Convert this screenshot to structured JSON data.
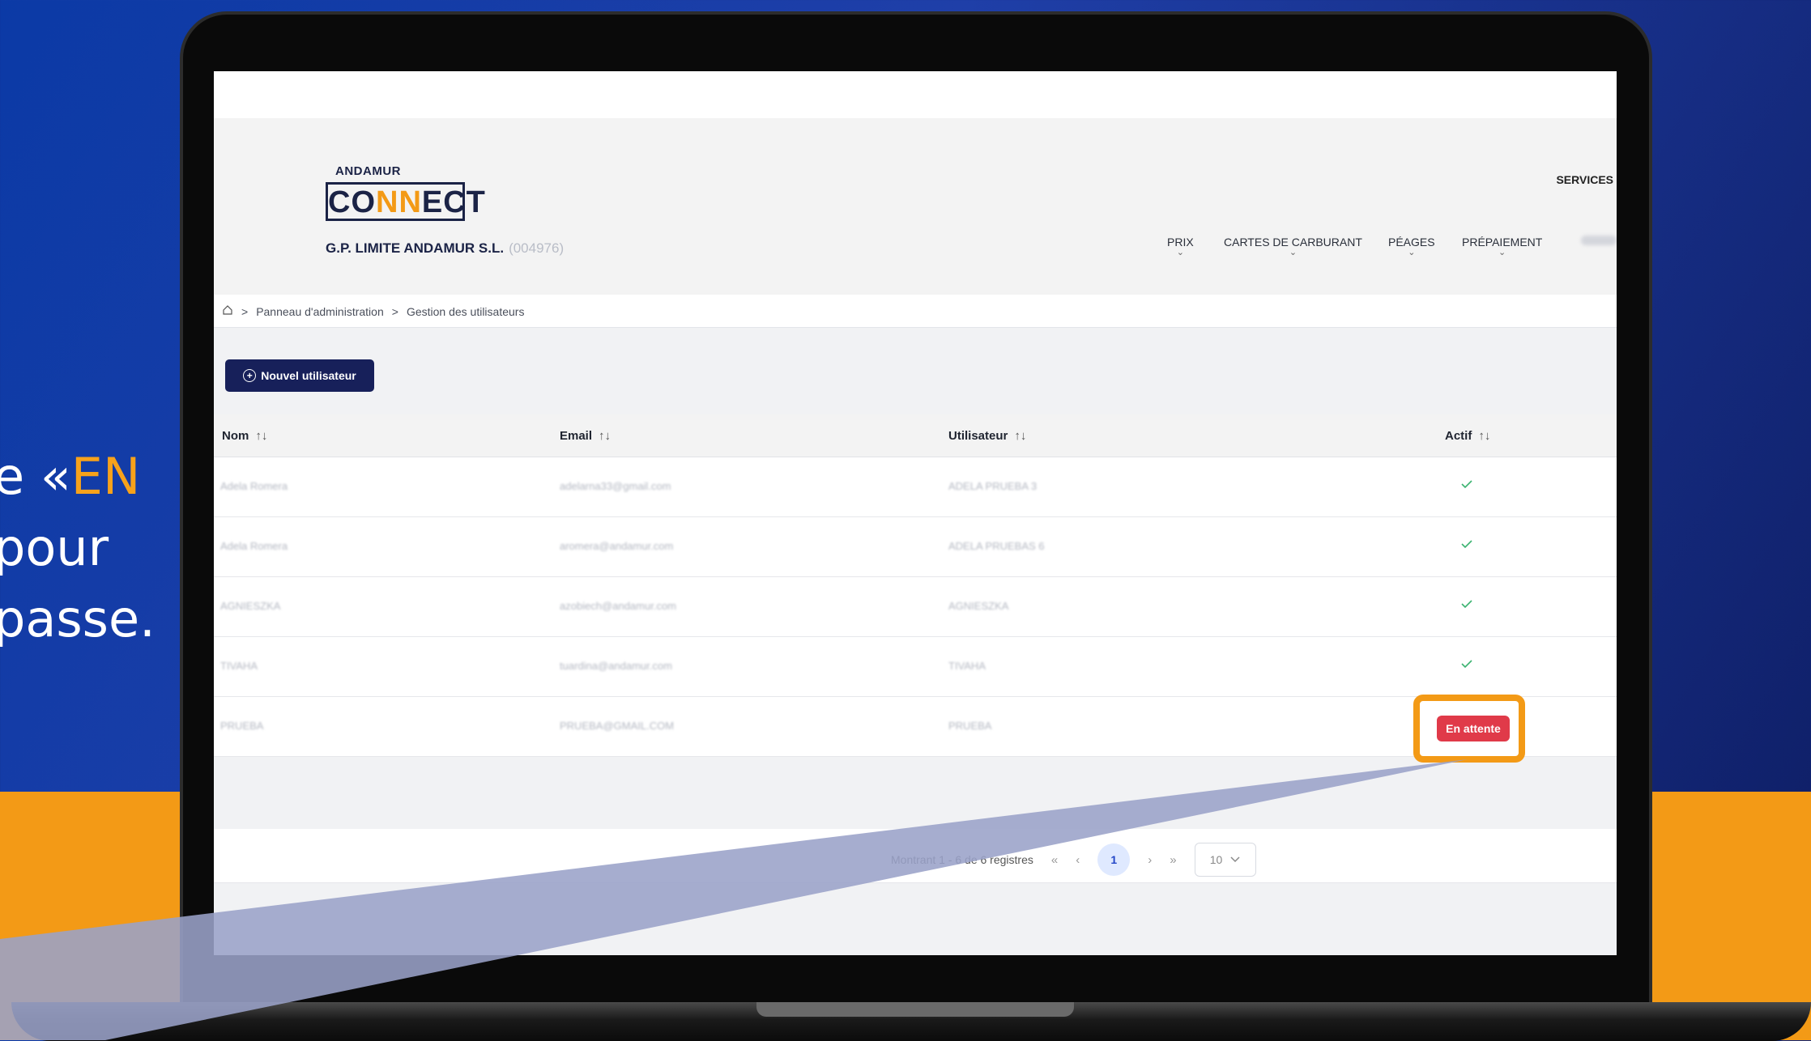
{
  "side_text": {
    "line1_prefix": "e «",
    "line1_highlight": "EN",
    "line2": "pour",
    "line3": "passe."
  },
  "logo": {
    "small": "ANDAMUR",
    "main_a": "CO",
    "main_b": "NN",
    "main_c": "ECT"
  },
  "company": {
    "name": "G.P. LIMITE ANDAMUR S.L.",
    "id": "(004976)"
  },
  "nav": {
    "services": "SERVICES",
    "items": [
      {
        "label": "PRIX",
        "chevron": "⌄"
      },
      {
        "label": "CARTES DE CARBURANT",
        "chevron": "⌄"
      },
      {
        "label": "PÉAGES",
        "chevron": "⌄"
      },
      {
        "label": "PRÉPAIEMENT",
        "chevron": "⌄"
      }
    ]
  },
  "breadcrumb": {
    "home_icon": "home-icon",
    "item1": "Panneau d'administration",
    "item2": "Gestion des utilisateurs",
    "separator": ">"
  },
  "new_user_button": "Nouvel utilisateur",
  "table": {
    "headers": [
      "Nom",
      "Email",
      "Utilisateur",
      "Actif"
    ],
    "sort_glyph": "↑↓",
    "rows": [
      {
        "nom": "Adela Romera",
        "email": "adelarna33@gmail.com",
        "user": "ADELA PRUEBA 3",
        "status": "active"
      },
      {
        "nom": "Adela Romera",
        "email": "aromera@andamur.com",
        "user": "ADELA PRUEBAS 6",
        "status": "active"
      },
      {
        "nom": "AGNIESZKA",
        "email": "azobiech@andamur.com",
        "user": "AGNIESZKA",
        "status": "active"
      },
      {
        "nom": "TIVAHA",
        "email": "tuardina@andamur.com",
        "user": "TIVAHA",
        "status": "active"
      },
      {
        "nom": "PRUEBA",
        "email": "PRUEBA@GMAIL.COM",
        "user": "PRUEBA",
        "status": "pending",
        "badge": "En attente"
      }
    ]
  },
  "pagination": {
    "summary": "Montrant 1 - 6 de 6 registres",
    "first": "«",
    "prev": "‹",
    "current": "1",
    "next": "›",
    "last": "»",
    "page_size": "10"
  },
  "colors": {
    "brand_navy": "#17205a",
    "accent_orange": "#f39a16",
    "badge_red": "#e03a49",
    "check_green": "#3cb371"
  }
}
